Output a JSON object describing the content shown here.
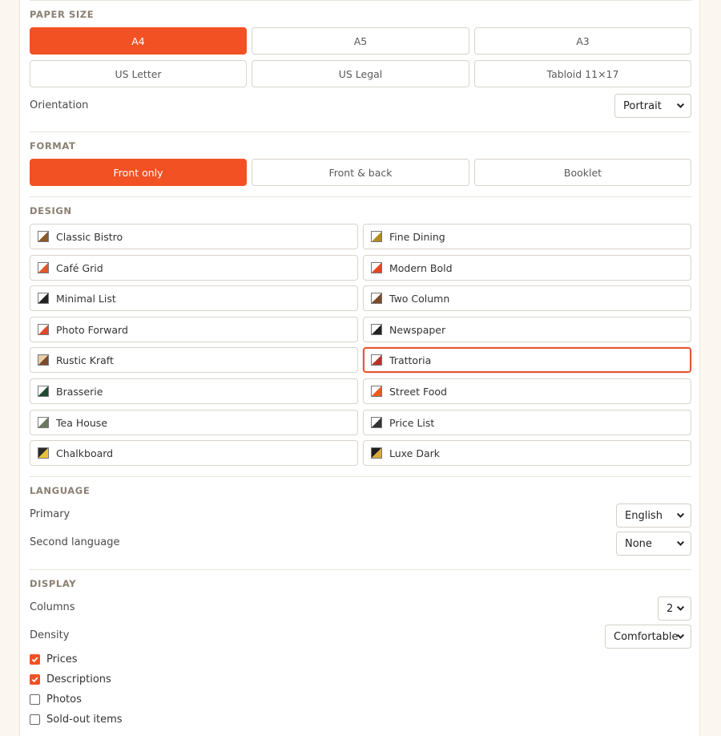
{
  "paper_size": {
    "title": "PAPER SIZE",
    "options": [
      "A4",
      "A5",
      "A3",
      "US Letter",
      "US Legal",
      "Tabloid 11×17"
    ],
    "selected": "A4",
    "orientation_label": "Orientation",
    "orientation_value": "Portrait"
  },
  "format": {
    "title": "FORMAT",
    "options": [
      "Front only",
      "Front & back",
      "Booklet"
    ],
    "selected": "Front only"
  },
  "design": {
    "title": "DESIGN",
    "items": [
      {
        "label": "Classic Bistro",
        "colors": [
          "#ffffff",
          "#8a5a2b"
        ]
      },
      {
        "label": "Fine Dining",
        "colors": [
          "#ffffff",
          "#b08d1a"
        ]
      },
      {
        "label": "Café Grid",
        "colors": [
          "#ffffff",
          "#e0582a"
        ]
      },
      {
        "label": "Modern Bold",
        "colors": [
          "#ffffff",
          "#e0481e"
        ]
      },
      {
        "label": "Minimal List",
        "colors": [
          "#ffffff",
          "#222222"
        ]
      },
      {
        "label": "Two Column",
        "colors": [
          "#ffffff",
          "#7a4a2a"
        ]
      },
      {
        "label": "Photo Forward",
        "colors": [
          "#ffffff",
          "#e04a2a"
        ]
      },
      {
        "label": "Newspaper",
        "colors": [
          "#ffffff",
          "#222222"
        ]
      },
      {
        "label": "Rustic Kraft",
        "colors": [
          "#e8cfa8",
          "#7a4a2a"
        ]
      },
      {
        "label": "Trattoria",
        "colors": [
          "#ffffff",
          "#b8322a"
        ]
      },
      {
        "label": "Brasserie",
        "colors": [
          "#ffffff",
          "#1e4a34"
        ]
      },
      {
        "label": "Street Food",
        "colors": [
          "#ffffff",
          "#ef5a1e"
        ]
      },
      {
        "label": "Tea House",
        "colors": [
          "#ffffff",
          "#6a7a5a"
        ]
      },
      {
        "label": "Price List",
        "colors": [
          "#ffffff",
          "#333333"
        ]
      },
      {
        "label": "Chalkboard",
        "colors": [
          "#2b2b2b",
          "#e8c23a"
        ]
      },
      {
        "label": "Luxe Dark",
        "colors": [
          "#1e1e1e",
          "#d8aa3a"
        ]
      }
    ],
    "selected": "Trattoria"
  },
  "language": {
    "title": "LANGUAGE",
    "primary_label": "Primary",
    "primary_value": "English",
    "second_label": "Second language",
    "second_value": "None"
  },
  "display": {
    "title": "DISPLAY",
    "columns_label": "Columns",
    "columns_value": "2",
    "density_label": "Density",
    "density_value": "Comfortable",
    "checks": [
      {
        "label": "Prices",
        "checked": true
      },
      {
        "label": "Descriptions",
        "checked": true
      },
      {
        "label": "Photos",
        "checked": false
      },
      {
        "label": "Sold-out items",
        "checked": false
      }
    ]
  },
  "colors": {
    "accent": "#f25124",
    "selected_border": "#e4572e"
  }
}
